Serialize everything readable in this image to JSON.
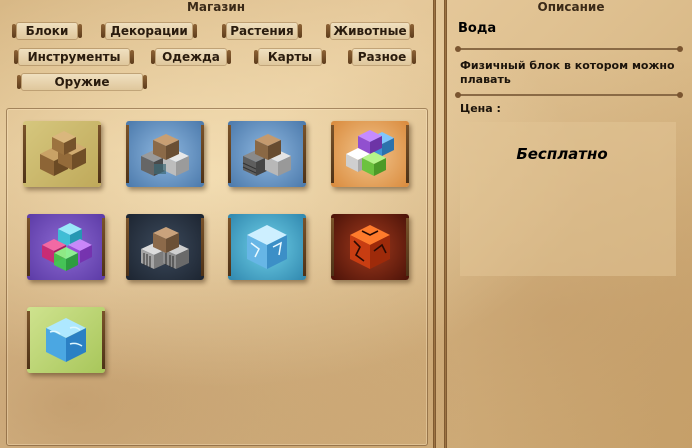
{
  "shop": {
    "title": "Магазин",
    "categories": [
      "Блоки",
      "Декорации",
      "Растения",
      "Животные",
      "Инструменты",
      "Одежда",
      "Карты",
      "Разное",
      "Оружие"
    ],
    "items": [
      {
        "icon": "wood-blocks-icon"
      },
      {
        "icon": "stone-blocks-icon"
      },
      {
        "icon": "brick-blocks-icon"
      },
      {
        "icon": "colored-blocks-icon"
      },
      {
        "icon": "glass-blocks-icon"
      },
      {
        "icon": "metal-grate-blocks-icon"
      },
      {
        "icon": "ice-block-icon"
      },
      {
        "icon": "lava-block-icon"
      },
      {
        "icon": "water-block-icon"
      }
    ]
  },
  "description": {
    "title": "Описание",
    "item_name": "Вода",
    "text": "Физичный блок в котором можно плавать",
    "price_label": "Цена :",
    "price_value": "Бесплатно"
  }
}
